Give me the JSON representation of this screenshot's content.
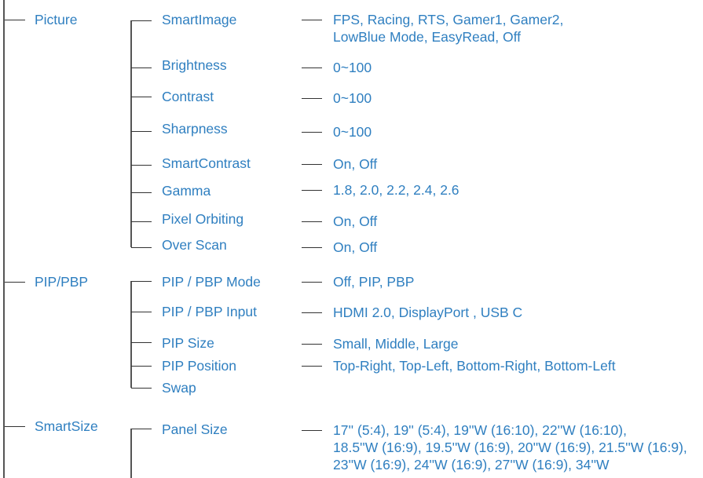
{
  "menu": [
    {
      "label": "Picture",
      "items": [
        {
          "label": "SmartImage",
          "values": [
            "FPS, Racing, RTS, Gamer1, Gamer2,",
            "LowBlue Mode, EasyRead, Off"
          ]
        },
        {
          "label": "Brightness",
          "values": [
            "0~100"
          ]
        },
        {
          "label": "Contrast",
          "values": [
            "0~100"
          ]
        },
        {
          "label": "Sharpness",
          "values": [
            "0~100"
          ]
        },
        {
          "label": "SmartContrast",
          "values": [
            "On, Off"
          ]
        },
        {
          "label": "Gamma",
          "values": [
            "1.8, 2.0, 2.2, 2.4, 2.6"
          ]
        },
        {
          "label": "Pixel Orbiting",
          "values": [
            "On, Off"
          ]
        },
        {
          "label": "Over Scan",
          "values": [
            "On, Off"
          ]
        }
      ]
    },
    {
      "label": "PIP/PBP",
      "items": [
        {
          "label": "PIP / PBP Mode",
          "values": [
            "Off, PIP, PBP"
          ]
        },
        {
          "label": "PIP / PBP Input",
          "values": [
            "HDMI 2.0, DisplayPort , USB C"
          ]
        },
        {
          "label": "PIP Size",
          "values": [
            "Small, Middle, Large"
          ]
        },
        {
          "label": "PIP Position",
          "values": [
            "Top-Right, Top-Left, Bottom-Right, Bottom-Left"
          ]
        },
        {
          "label": "Swap",
          "values": []
        }
      ]
    },
    {
      "label": "SmartSize",
      "items": [
        {
          "label": "Panel Size",
          "values": [
            "17'' (5:4), 19'' (5:4), 19''W (16:10), 22''W (16:10),",
            "18.5''W (16:9), 19.5''W (16:9), 20''W (16:9), 21.5''W (16:9),",
            "23''W (16:9), 24''W (16:9), 27''W (16:9), 34''W"
          ]
        }
      ]
    }
  ],
  "colors": {
    "text": "#2f7fc0",
    "lines": "#333333"
  }
}
